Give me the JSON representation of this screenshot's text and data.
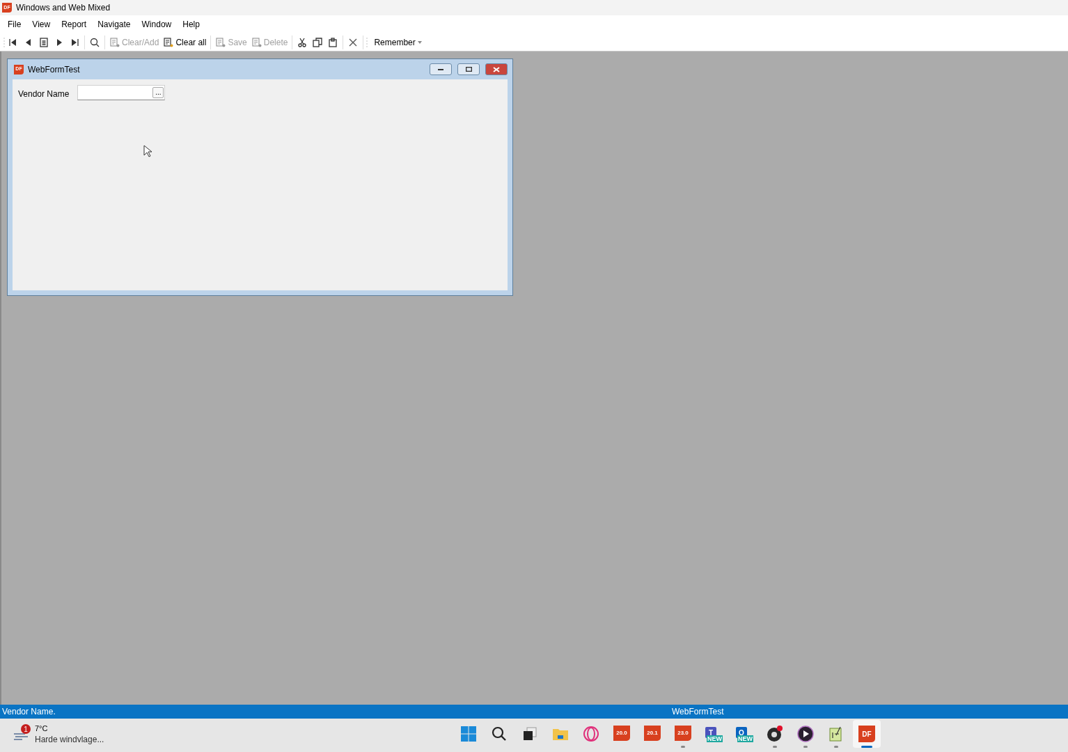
{
  "window": {
    "title": "Windows and Web Mixed",
    "logo": "DF"
  },
  "menu": [
    "File",
    "View",
    "Report",
    "Navigate",
    "Window",
    "Help"
  ],
  "toolbar": [
    {
      "kind": "first"
    },
    {
      "kind": "prev"
    },
    {
      "kind": "list"
    },
    {
      "kind": "next"
    },
    {
      "kind": "last"
    },
    {
      "kind": "sep"
    },
    {
      "kind": "find"
    },
    {
      "kind": "sep"
    },
    {
      "kind": "clear",
      "label": "Clear/Add",
      "disabled": true
    },
    {
      "kind": "clearall",
      "label": "Clear all",
      "disabled": false
    },
    {
      "kind": "sep"
    },
    {
      "kind": "save",
      "label": "Save",
      "disabled": true
    },
    {
      "kind": "delete",
      "label": "Delete",
      "disabled": true
    },
    {
      "kind": "sep"
    },
    {
      "kind": "cut"
    },
    {
      "kind": "copy"
    },
    {
      "kind": "paste"
    },
    {
      "kind": "sep"
    },
    {
      "kind": "cancel"
    },
    {
      "kind": "sep"
    },
    {
      "kind": "dropdown",
      "label": "Remember"
    }
  ],
  "child_window": {
    "title": "WebFormTest",
    "logo": "DF",
    "field": {
      "label": "Vendor Name",
      "button": "..."
    }
  },
  "status_bar": {
    "left": "Vendor Name.",
    "center": "WebFormTest"
  },
  "taskbar": {
    "weather": {
      "temperature": "7°C",
      "description": "Harde windvlage...",
      "badge": "1"
    },
    "apps": [
      {
        "kind": "start",
        "running": false,
        "active": false
      },
      {
        "kind": "search",
        "running": false,
        "active": false
      },
      {
        "kind": "taskview",
        "running": false,
        "active": false
      },
      {
        "kind": "folder",
        "running": false,
        "active": false
      },
      {
        "kind": "ring",
        "running": false,
        "active": false
      },
      {
        "kind": "version",
        "label": "20.0",
        "running": false,
        "active": false
      },
      {
        "kind": "version",
        "label": "20.1",
        "running": false,
        "active": false
      },
      {
        "kind": "version",
        "label": "23.0",
        "running": true,
        "active": false
      },
      {
        "kind": "teams",
        "label": "T",
        "badge": "NEW",
        "running": false,
        "active": false
      },
      {
        "kind": "outlook",
        "label": "O",
        "badge": "NEW",
        "running": false,
        "active": false
      },
      {
        "kind": "obs",
        "running": true,
        "active": false
      },
      {
        "kind": "player",
        "running": true,
        "active": false
      },
      {
        "kind": "notepad",
        "running": true,
        "active": false
      },
      {
        "kind": "df",
        "label": "DF",
        "running": true,
        "active": true
      }
    ]
  }
}
